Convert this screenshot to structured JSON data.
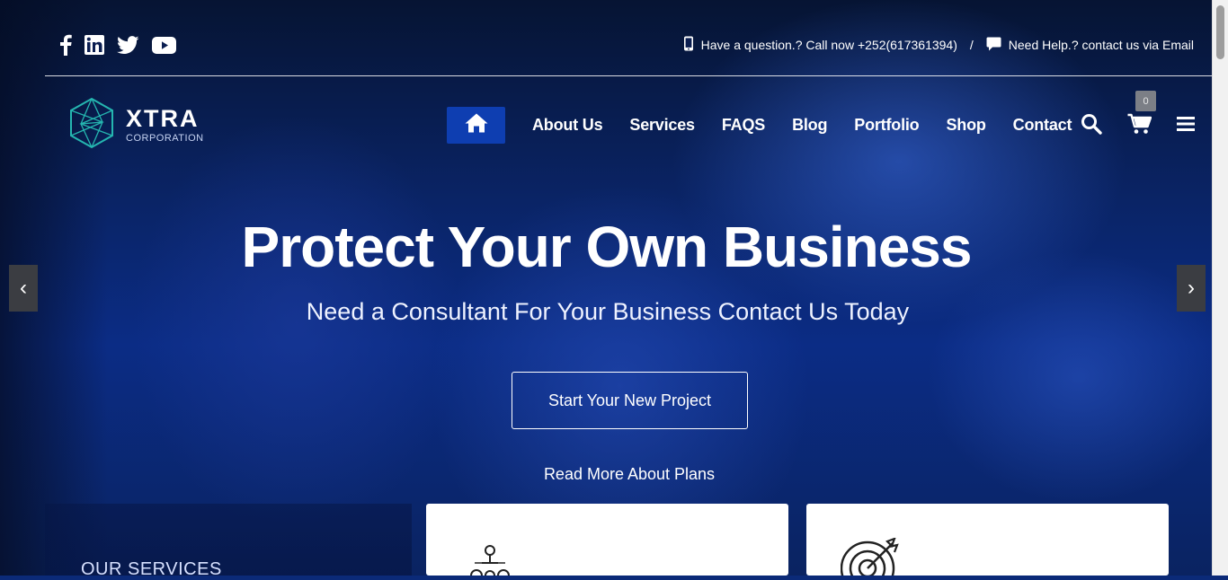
{
  "topbar": {
    "social": [
      "facebook-icon",
      "linkedin-icon",
      "twitter-icon",
      "youtube-icon"
    ],
    "phone_text": "Have a question.? Call now +252(617361394)",
    "separator": "/",
    "help_text": "Need Help.? contact us via Email"
  },
  "logo": {
    "name": "XTRA",
    "tagline": "CORPORATION"
  },
  "nav": {
    "items": [
      "About Us",
      "Services",
      "FAQS",
      "Blog",
      "Portfolio",
      "Shop",
      "Contact"
    ],
    "cart_count": "0"
  },
  "hero": {
    "title": "Protect Your Own Business",
    "subtitle": "Need a Consultant For Your Business Contact Us Today",
    "cta_label": "Start Your New Project",
    "link_label": "Read More About Plans",
    "prev": "‹",
    "next": "›"
  },
  "services": {
    "title": "OUR SERVICES"
  },
  "colors": {
    "accent": "#0e3eb1",
    "hero_overlay": "#0b2c85"
  }
}
